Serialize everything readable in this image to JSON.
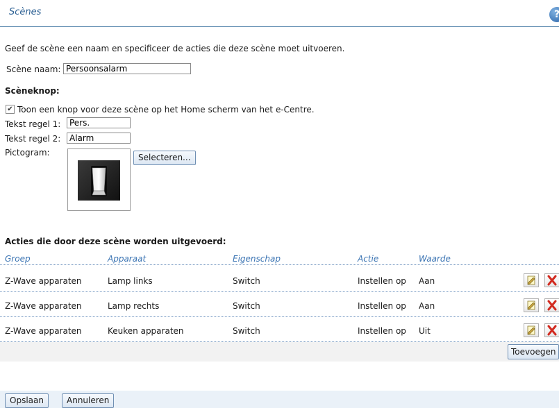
{
  "header": {
    "title": "Scènes",
    "help_icon": "help-icon"
  },
  "intro": "Geef de scène een naam en specificeer de acties die deze scène moet uitvoeren.",
  "scene_name": {
    "label": "Scène naam:",
    "value": "Persoonsalarm"
  },
  "scene_button": {
    "heading": "Scèneknop:",
    "checkbox_label": "Toon een knop voor deze scène op het Home scherm van het e-Centre.",
    "checked": true,
    "line1_label": "Tekst regel 1:",
    "line1_value": "Pers.",
    "line2_label": "Tekst regel 2:",
    "line2_value": "Alarm",
    "icon_label": "Pictogram:",
    "icon": "light-switch-icon",
    "select_button": "Selecteren..."
  },
  "actions": {
    "heading": "Acties die door deze scène worden uitgevoerd:",
    "columns": [
      "Groep",
      "Apparaat",
      "Eigenschap",
      "Actie",
      "Waarde"
    ],
    "rows": [
      [
        "Z-Wave apparaten",
        "Lamp links",
        "Switch",
        "Instellen op",
        "Aan"
      ],
      [
        "Z-Wave apparaten",
        "Lamp rechts",
        "Switch",
        "Instellen op",
        "Aan"
      ],
      [
        "Z-Wave apparaten",
        "Keuken apparaten",
        "Switch",
        "Instellen op",
        "Uit"
      ]
    ],
    "row_icons": [
      "edit-icon",
      "delete-icon"
    ],
    "add_button": "Toevoegen"
  },
  "footer": {
    "save_button": "Opslaan",
    "cancel_button": "Annuleren"
  },
  "colors": {
    "accent": "#2b5f93",
    "header_text": "#3b74b3",
    "delete": "#d22a1f"
  }
}
